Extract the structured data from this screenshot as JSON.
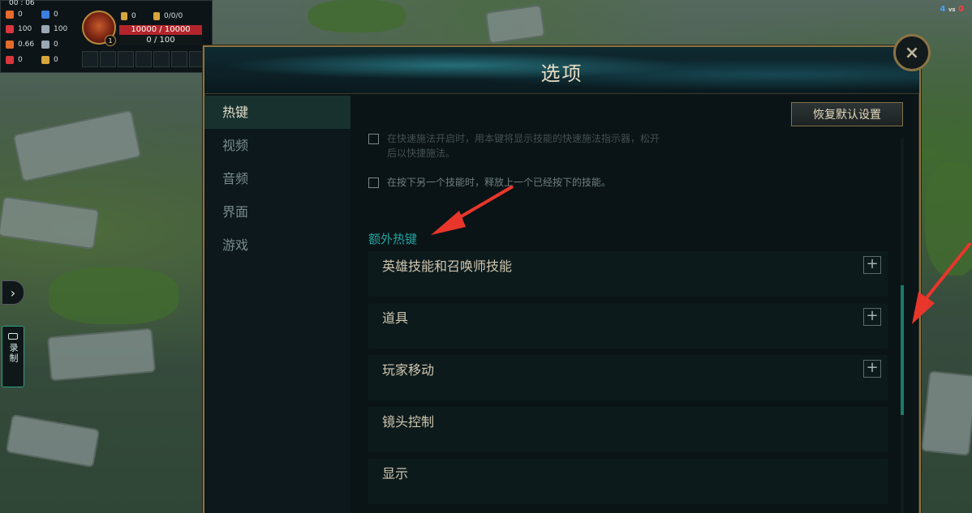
{
  "hud": {
    "timer": "00 : 06",
    "stats_left": [
      {
        "icon": "attack-damage-icon",
        "color": "#e36b2b",
        "value": "0"
      },
      {
        "icon": "armor-icon",
        "color": "#d9363e",
        "value": "100"
      },
      {
        "icon": "attack-speed-icon",
        "color": "#e36b2b",
        "value": "0.66"
      },
      {
        "icon": "crit-icon",
        "color": "#d9363e",
        "value": "0"
      }
    ],
    "stats_mid": [
      {
        "icon": "ability-power-icon",
        "color": "#3d7ee0",
        "value": "0"
      },
      {
        "icon": "magic-resist-icon",
        "color": "#9aa7b5",
        "value": "100"
      },
      {
        "icon": "cooldown-icon",
        "color": "#9aa7b5",
        "value": "0"
      },
      {
        "icon": "move-speed-icon",
        "color": "#d6a53c",
        "value": "0"
      }
    ],
    "gold": "0",
    "kda": "0/0/0",
    "level": "1",
    "health": "10000 / 10000",
    "mana": "0 / 100"
  },
  "score": {
    "blue": "4",
    "vs": "vs",
    "red": "0"
  },
  "record_label": "录制",
  "dialog": {
    "title": "选项",
    "close": "×",
    "nav": [
      "热键",
      "视频",
      "音频",
      "界面",
      "游戏"
    ],
    "active_nav": "热键",
    "reset_label": "恢复默认设置",
    "options": [
      {
        "text": "在快速施法开启时，用本键将显示技能的快速施法指示器，松开后以快捷施法。",
        "checked": false
      },
      {
        "text": "在按下另一个技能时，释放上一个已经按下的技能。",
        "checked": false
      }
    ],
    "section_title": "额外热键",
    "categories": [
      {
        "label": "英雄技能和召唤师技能",
        "expand": "+"
      },
      {
        "label": "道具",
        "expand": "+"
      },
      {
        "label": "玩家移动",
        "expand": "+"
      },
      {
        "label": "镜头控制",
        "expand": ""
      },
      {
        "label": "显示",
        "expand": ""
      }
    ]
  },
  "colors": {
    "accent_teal": "#1fa5a1",
    "gold_border": "#8a7444",
    "health_red": "#b2252b",
    "annotation_red": "#e8362b"
  }
}
